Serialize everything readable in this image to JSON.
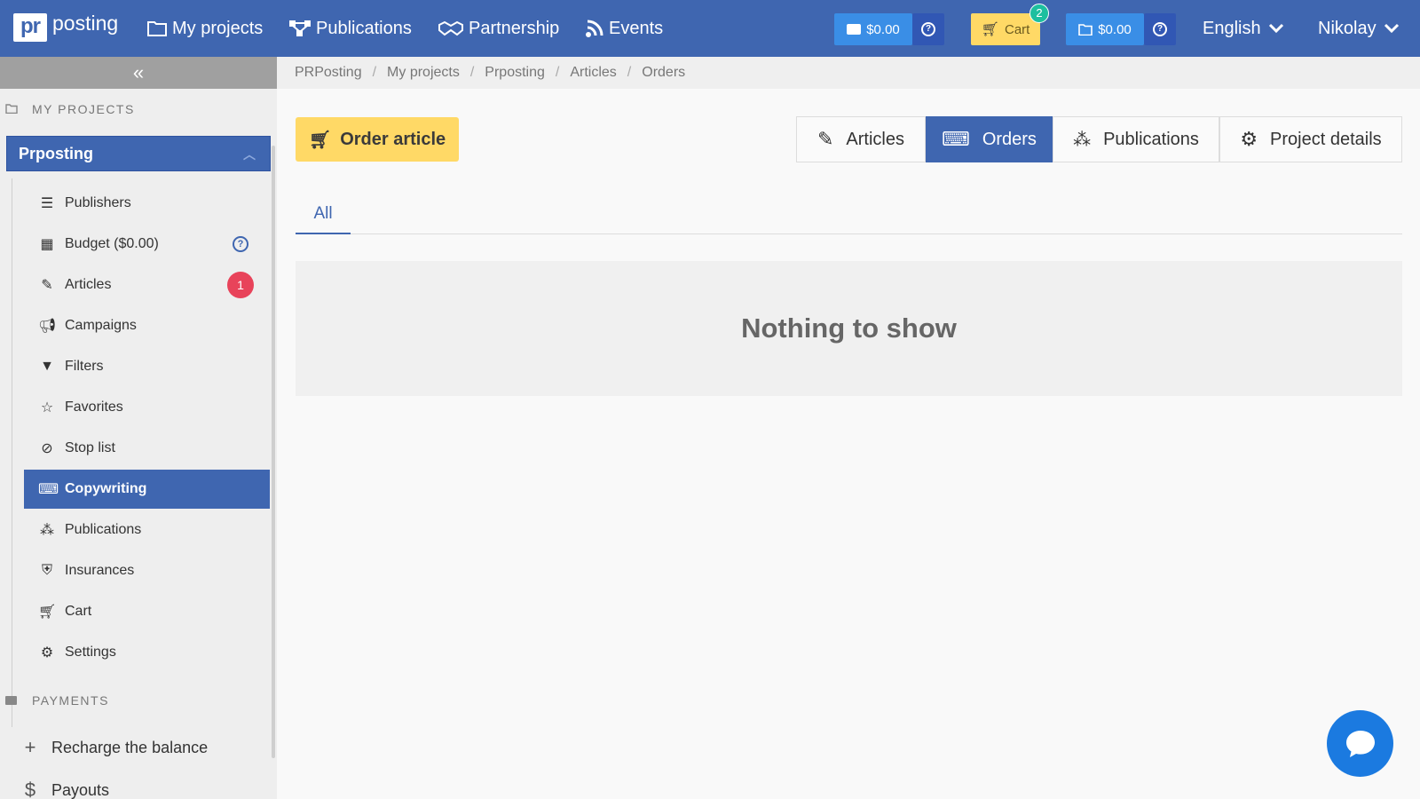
{
  "brand": {
    "logo_mark": "pr",
    "logo_text": "posting"
  },
  "topnav": {
    "my_projects": "My projects",
    "publications": "Publications",
    "partnership": "Partnership",
    "events": "Events"
  },
  "topbar": {
    "wallet_balance": "$0.00",
    "cart_label": "Cart",
    "cart_count": "2",
    "projects_balance": "$0.00",
    "language": "English",
    "user": "Nikolay"
  },
  "sidebar": {
    "collapse_symbol": "«",
    "section_projects": "MY PROJECTS",
    "project_name": "Prposting",
    "items": [
      {
        "label": "Publishers",
        "icon": "list-icon"
      },
      {
        "label": "Budget ($0.00)",
        "icon": "calculator-icon"
      },
      {
        "label": "Articles",
        "icon": "pencil-icon",
        "badge": "1"
      },
      {
        "label": "Campaigns",
        "icon": "megaphone-icon"
      },
      {
        "label": "Filters",
        "icon": "filter-icon"
      },
      {
        "label": "Favorites",
        "icon": "star-icon"
      },
      {
        "label": "Stop list",
        "icon": "ban-icon"
      },
      {
        "label": "Copywriting",
        "icon": "keyboard-icon",
        "active": true
      },
      {
        "label": "Publications",
        "icon": "network-icon"
      },
      {
        "label": "Insurances",
        "icon": "shield-icon"
      },
      {
        "label": "Cart",
        "icon": "cart-icon"
      },
      {
        "label": "Settings",
        "icon": "gears-icon"
      }
    ],
    "section_payments": "PAYMENTS",
    "payments": [
      {
        "label": "Recharge the balance",
        "icon": "plus-icon"
      },
      {
        "label": "Payouts",
        "icon": "payout-icon"
      }
    ]
  },
  "breadcrumb": [
    "PRPosting",
    "My projects",
    "Prposting",
    "Articles",
    "Orders"
  ],
  "main": {
    "order_button": "Order article",
    "segments": [
      "Articles",
      "Orders",
      "Publications",
      "Project details"
    ],
    "active_segment": "Orders",
    "filter_tab": "All",
    "empty_text": "Nothing to show"
  },
  "colors": {
    "brand": "#3f66b0",
    "accent_yellow": "#ffd966",
    "badge_red": "#e8435a",
    "badge_green": "#1dbf9f",
    "chat": "#1b7ae0"
  }
}
